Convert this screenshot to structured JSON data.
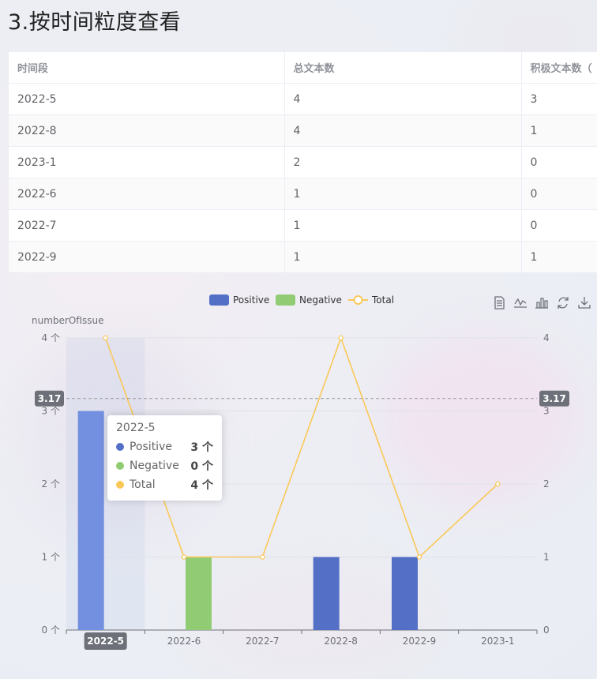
{
  "heading": "3.按时间粒度查看",
  "table": {
    "columns": [
      "时间段",
      "总文本数",
      "积极文本数（"
    ],
    "rows": [
      [
        "2022-5",
        "4",
        "3"
      ],
      [
        "2022-8",
        "4",
        "1"
      ],
      [
        "2023-1",
        "2",
        "0"
      ],
      [
        "2022-6",
        "1",
        "0"
      ],
      [
        "2022-7",
        "1",
        "0"
      ],
      [
        "2022-9",
        "1",
        "1"
      ]
    ]
  },
  "chart_data": {
    "type": "bar",
    "categories": [
      "2022-5",
      "2022-6",
      "2022-7",
      "2022-8",
      "2022-9",
      "2023-1"
    ],
    "series": [
      {
        "name": "Positive",
        "type": "bar",
        "color": "#5470c6",
        "values": [
          3,
          0,
          0,
          1,
          1,
          0
        ]
      },
      {
        "name": "Negative",
        "type": "bar",
        "color": "#91cc75",
        "values": [
          0,
          1,
          0,
          0,
          0,
          0
        ]
      },
      {
        "name": "Total",
        "type": "line",
        "color": "#fac858",
        "values": [
          4,
          1,
          1,
          4,
          1,
          2
        ]
      }
    ],
    "ylabel": "numberOfIssue",
    "y_unit": "个",
    "ylim": [
      0,
      4
    ],
    "yticks": [
      0,
      1,
      2,
      3,
      4
    ],
    "legend_position": "top-center",
    "grid": true,
    "hover": {
      "category": "2022-5",
      "y_value": "3.17"
    },
    "tooltip": {
      "title": "2022-5",
      "rows": [
        {
          "name": "Positive",
          "value": "3 个",
          "color": "#5470c6"
        },
        {
          "name": "Negative",
          "value": "0 个",
          "color": "#91cc75"
        },
        {
          "name": "Total",
          "value": "4 个",
          "color": "#fac858"
        }
      ]
    }
  },
  "toolbox": [
    {
      "icon": "data-view-icon"
    },
    {
      "icon": "line-chart-icon"
    },
    {
      "icon": "bar-chart-icon"
    },
    {
      "icon": "restore-icon"
    },
    {
      "icon": "save-image-icon"
    }
  ]
}
